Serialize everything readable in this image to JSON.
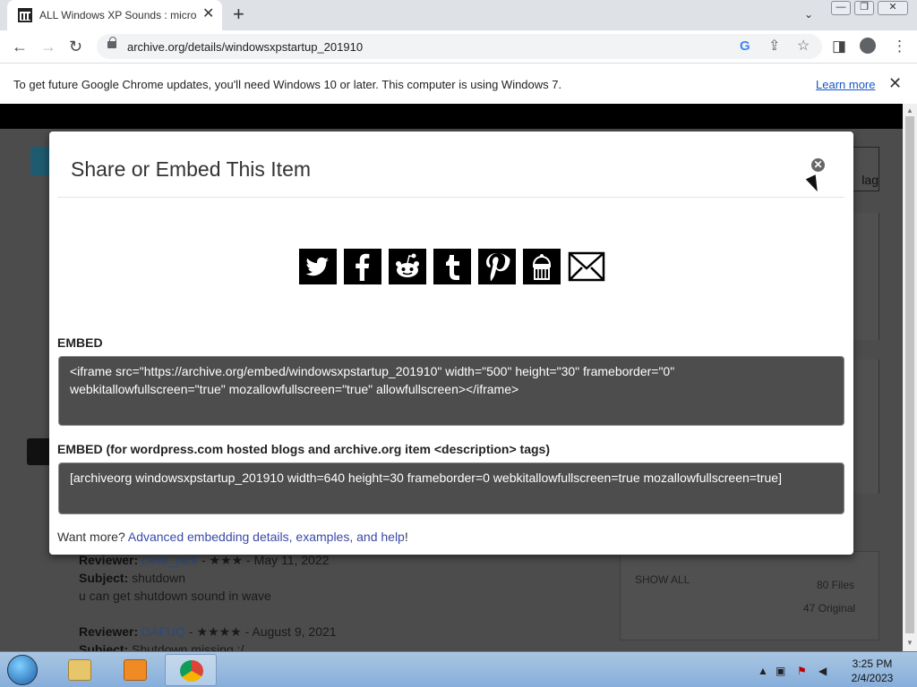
{
  "browser": {
    "tab_title": "ALL Windows XP Sounds : microsoft",
    "tab_close": "✕",
    "new_tab": "+",
    "tab_search": "⌄",
    "window_buttons": [
      "—",
      "❐",
      "✕"
    ],
    "url": "archive.org/details/windowsxpstartup_201910",
    "google_letter": "G",
    "menu": "⋮",
    "back": "←",
    "forward": "→",
    "reload": "↻",
    "share_glyph": "⇪",
    "bookmark_glyph": "☆",
    "sidepanel_glyph": "◨"
  },
  "infobar": {
    "message": "To get future Google Chrome updates, you'll need Windows 10 or later. This computer is using Windows 7.",
    "link": "Learn more",
    "close": "✕"
  },
  "modal": {
    "title": "Share or Embed This Item",
    "close_glyph": "✕",
    "share_icons": [
      {
        "name": "twitter-icon",
        "glyph": "🐦"
      },
      {
        "name": "facebook-icon",
        "glyph": "f"
      },
      {
        "name": "reddit-icon",
        "glyph": "👽"
      },
      {
        "name": "tumblr-icon",
        "glyph": "t"
      },
      {
        "name": "pinterest-icon",
        "glyph": "p"
      },
      {
        "name": "archive-icon",
        "glyph": "🏛"
      },
      {
        "name": "email-icon",
        "glyph": "✉"
      }
    ],
    "embed_label": "EMBED",
    "embed_code": "<iframe src=\"https://archive.org/embed/windowsxpstartup_201910\" width=\"500\" height=\"30\" frameborder=\"0\" webkitallowfullscreen=\"true\" mozallowfullscreen=\"true\" allowfullscreen></iframe>",
    "embed_wp_label": "EMBED (for wordpress.com hosted blogs and archive.org item <description> tags)",
    "embed_wp_code": "[archiveorg windowsxpstartup_201910 width=640 height=30 frameborder=0 webkitallowfullscreen=true mozallowfullscreen=true]",
    "want_more": "Want more?",
    "want_more_link": "Advanced embedding details, examples, and help",
    "want_more_end": "!"
  },
  "background": {
    "flag_label": "lag",
    "show_all": "SHOW ALL",
    "files_count": "80 Files",
    "files_original": "47 Original",
    "reviews": [
      {
        "label": "Reviewer:",
        "name": "clear_jack",
        "meta": " - ★★★ - May 11, 2022"
      },
      {
        "label": "Subject:",
        "value": "shutdown"
      },
      {
        "text": "u can get shutdown sound in wave"
      },
      {
        "label": "Reviewer:",
        "name": "DAFUQ",
        "meta": " - ★★★★ - August 9, 2021"
      },
      {
        "label": "Subject:",
        "value": "Shutdown missing :/"
      }
    ]
  },
  "taskbar": {
    "time": "3:25 PM",
    "date": "2/4/2023",
    "tray_arrow": "▲"
  }
}
